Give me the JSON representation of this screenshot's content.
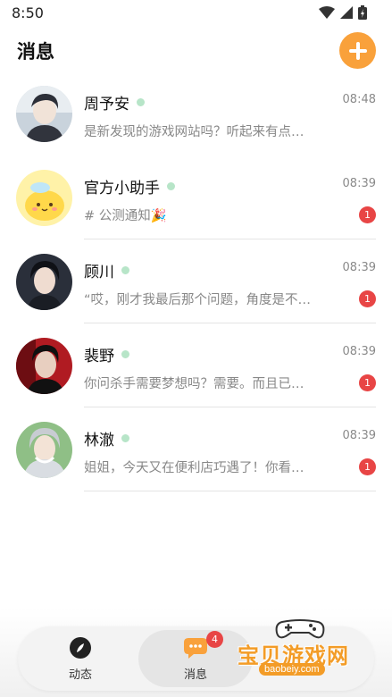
{
  "status_bar": {
    "time": "8:50"
  },
  "header": {
    "title": "消息"
  },
  "conversations": [
    {
      "name": "周予安",
      "time": "08:48",
      "preview": "是新发现的游戏网站吗？听起来有点…",
      "unread": ""
    },
    {
      "name": "官方小助手",
      "time": "08:39",
      "preview": "# 公测通知🎉",
      "unread": "1"
    },
    {
      "name": "顾川",
      "time": "08:39",
      "preview": "“哎，刚才我最后那个问题，角度是不…",
      "unread": "1"
    },
    {
      "name": "裴野",
      "time": "08:39",
      "preview": "你问杀手需要梦想吗？需要。而且已…",
      "unread": "1"
    },
    {
      "name": "林澈",
      "time": "08:39",
      "preview": "姐姐，今天又在便利店巧遇了！你看…",
      "unread": "1"
    }
  ],
  "bottom_nav": {
    "items": [
      {
        "label": "动态"
      },
      {
        "label": "消息"
      }
    ],
    "messages_badge": "4"
  },
  "watermark": {
    "text": "宝贝游戏网",
    "domain": "baobeiy.com"
  },
  "colors": {
    "accent": "#f9a13b",
    "badge": "#e84545",
    "online": "#b7e5c8"
  }
}
